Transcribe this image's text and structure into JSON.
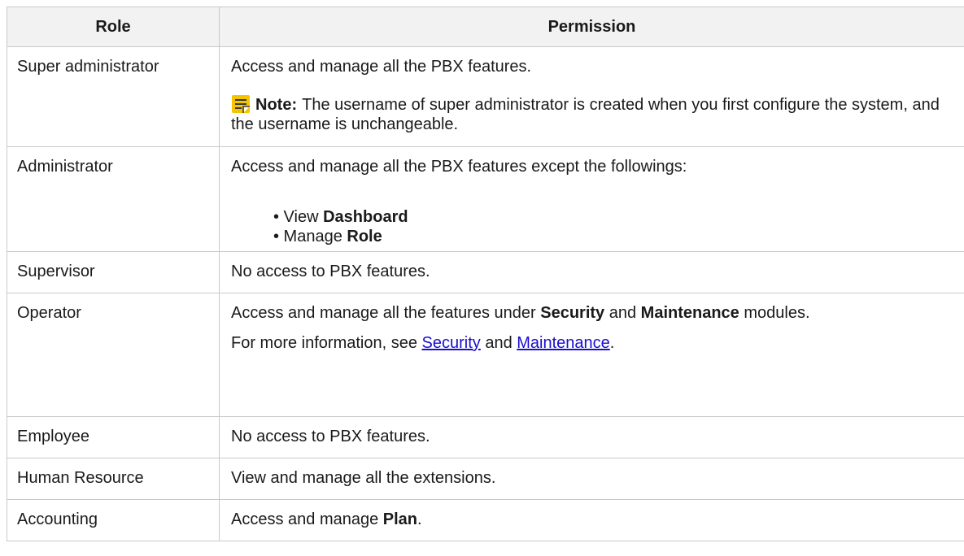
{
  "headers": {
    "role": "Role",
    "permission": "Permission"
  },
  "rows": {
    "super_admin": {
      "role": "Super administrator",
      "perm": "Access and manage all the PBX features.",
      "note_label": "Note:",
      "note_text": "The username of super administrator is created when you first configure the system, and the username is unchangeable."
    },
    "admin": {
      "role": "Administrator",
      "perm": "Access and manage all the PBX features except the followings:",
      "items": [
        {
          "prefix": "• View ",
          "bold": "Dashboard"
        },
        {
          "prefix": "• Manage ",
          "bold": "Role"
        }
      ]
    },
    "supervisor": {
      "role": "Supervisor",
      "perm": "No access to PBX features."
    },
    "operator": {
      "role": "Operator",
      "perm_a": "Access and manage all the features under ",
      "perm_b": "Security",
      "perm_c": " and ",
      "perm_d": "Maintenance",
      "perm_e": " modules.",
      "info_a": "For more information, see ",
      "link1": "Security",
      "info_b": " and ",
      "link2": "Maintenance",
      "info_c": "."
    },
    "employee": {
      "role": "Employee",
      "perm": "No access to PBX features."
    },
    "hr": {
      "role": "Human Resource",
      "perm": "View and manage all the extensions."
    },
    "accounting": {
      "role": "Accounting",
      "perm_a": "Access and manage ",
      "perm_b": "Plan",
      "perm_c": "."
    }
  },
  "colors": {
    "header_bg": "#f2f2f2",
    "border": "#c9c9c9",
    "link": "#1a0dce",
    "note_icon": "#f5c400"
  },
  "icons": {
    "note": "note-icon"
  }
}
